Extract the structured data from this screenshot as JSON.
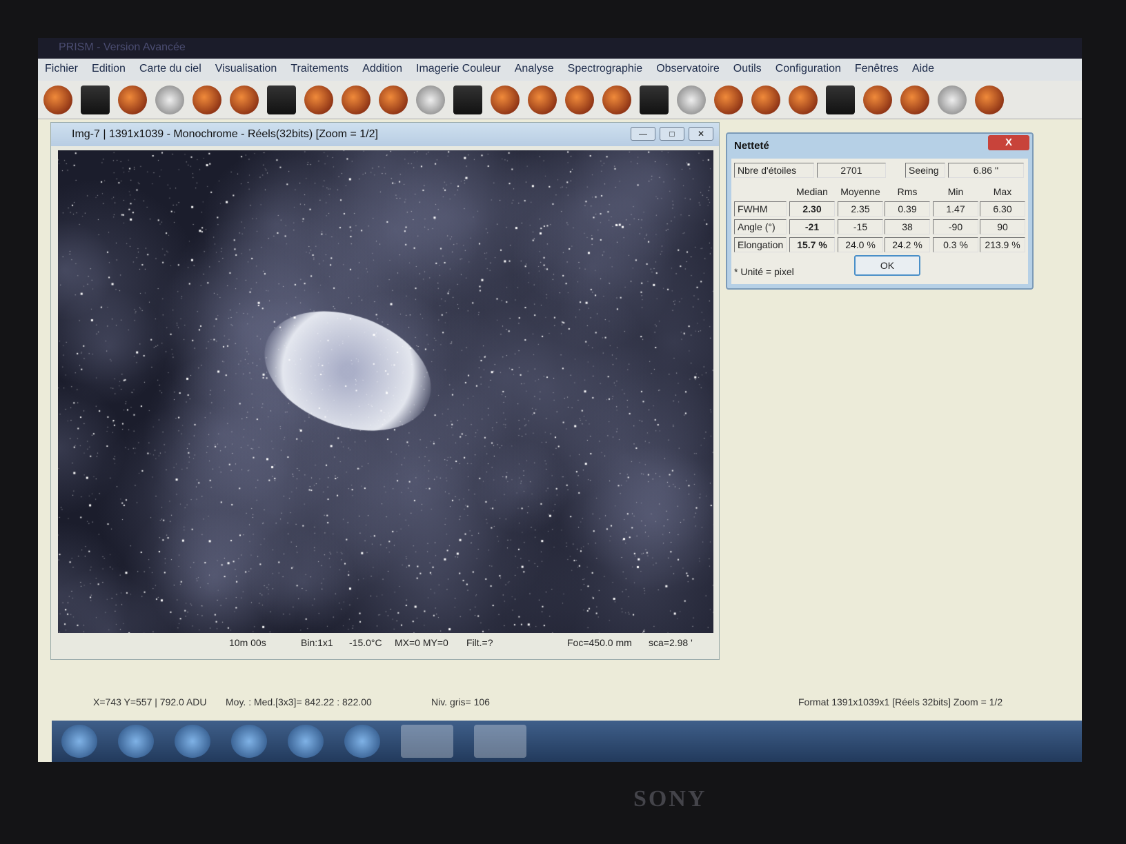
{
  "app": {
    "title": "PRISM - Version Avancée"
  },
  "menu": [
    "Fichier",
    "Edition",
    "Carte du ciel",
    "Visualisation",
    "Traitements",
    "Addition",
    "Imagerie Couleur",
    "Analyse",
    "Spectrographie",
    "Observatoire",
    "Outils",
    "Configuration",
    "Fenêtres",
    "Aide"
  ],
  "toolbar_icons": [
    "open-icon",
    "save-icon",
    "edit-icon",
    "info-icon",
    "rotate-left-icon",
    "rotate-right-icon",
    "contrast-icon",
    "zoom-out-icon",
    "zoom-in-icon",
    "galaxy-icon",
    "gear-icon",
    "camera-1-icon",
    "camera-2-icon",
    "camera-3-icon",
    "focuser-icon",
    "telescope-icon",
    "cone-icon",
    "moon-icon",
    "tool-icon",
    "histogram-icon",
    "magnet-icon",
    "curve-icon",
    "chart-icon",
    "frame-icon",
    "profile-icon",
    "wheel-icon"
  ],
  "image_window": {
    "title": "Img-7 | 1391x1039 - Monochrome - Réels(32bits)   [Zoom = 1/2]",
    "footer": {
      "exposure": "10m 00s",
      "bin": "Bin:1x1",
      "temp": "-15.0°C",
      "mxmy": "MX=0 MY=0",
      "filter": "Filt.=?",
      "focal": "Foc=450.0 mm",
      "scale": "sca=2.98 '"
    }
  },
  "dialog": {
    "title": "Netteté",
    "close": "X",
    "stars_label": "Nbre d'étoiles",
    "stars": "2701",
    "seeing_label": "Seeing",
    "seeing": "6.86 ''",
    "columns": [
      "Median",
      "Moyenne",
      "Rms",
      "Min",
      "Max"
    ],
    "rows": [
      {
        "label": "FWHM",
        "values": [
          "2.30",
          "2.35",
          "0.39",
          "1.47",
          "6.30"
        ]
      },
      {
        "label": "Angle (°)",
        "values": [
          "-21",
          "-15",
          "38",
          "-90",
          "90"
        ]
      },
      {
        "label": "Elongation",
        "values": [
          "15.7 %",
          "24.0 %",
          "24.2 %",
          "0.3 %",
          "213.9 %"
        ]
      }
    ],
    "unit_note": "* Unité = pixel",
    "ok": "OK"
  },
  "status": {
    "coords": "X=743 Y=557 | 792.0 ADU",
    "stats": "Moy. : Med.[3x3]= 842.22 : 822.00",
    "gray": "Niv. gris= 106",
    "format": "Format 1391x1039x1  [Réels 32bits]  Zoom = 1/2"
  },
  "taskbar": [
    "start-icon",
    "media-player-icon",
    "word-icon",
    "phd-icon",
    "chrome-icon",
    "app-icon",
    "prism-icon",
    "refresh-icon"
  ],
  "brand": "SONY"
}
